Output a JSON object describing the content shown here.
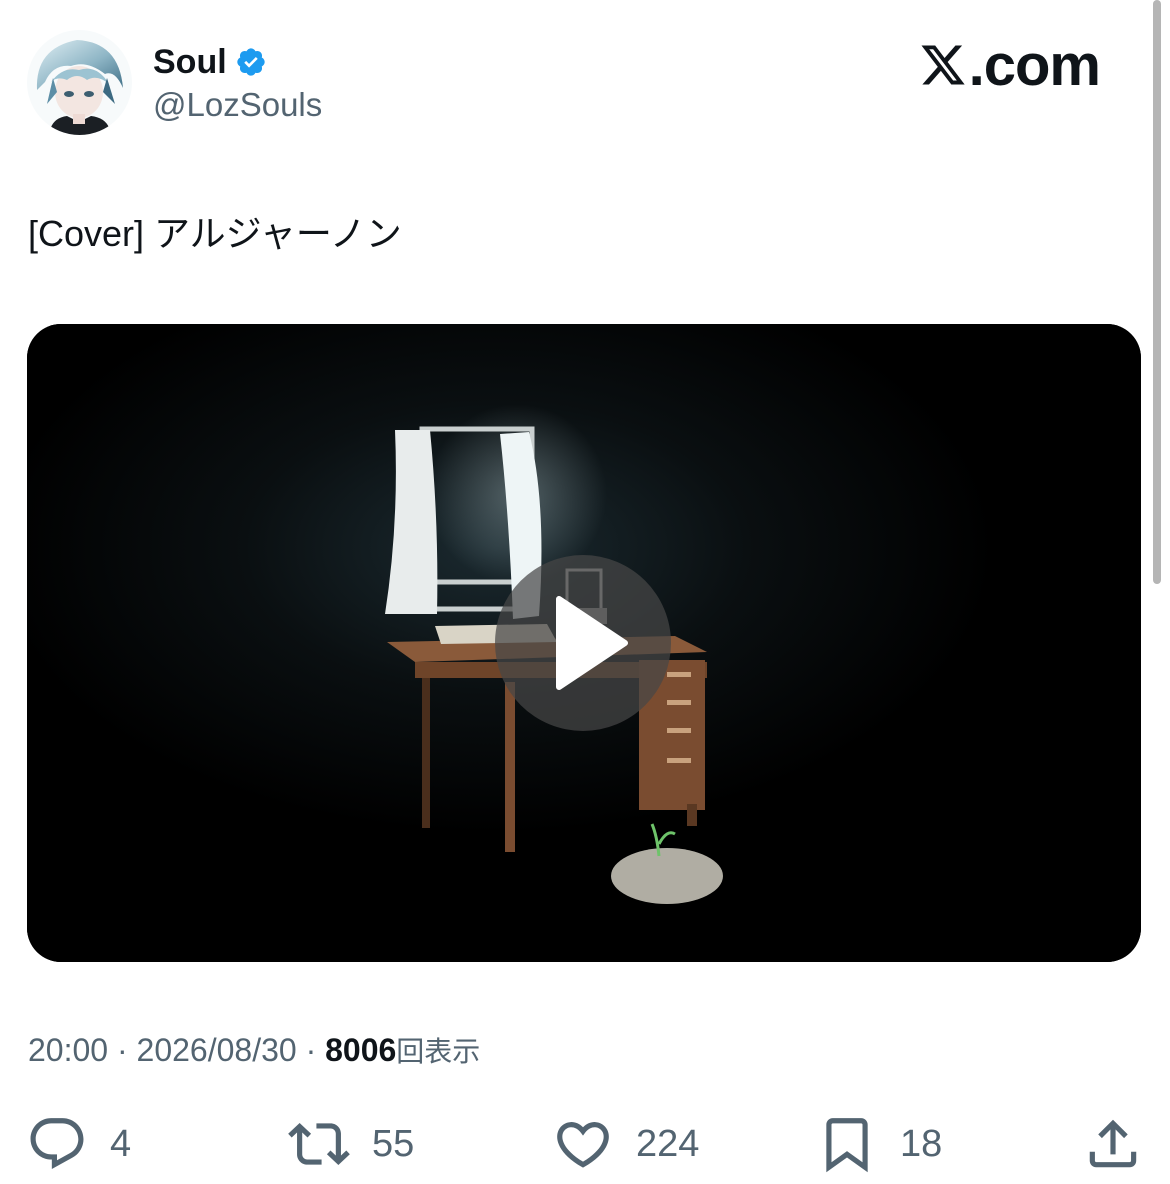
{
  "author": {
    "display_name": "Soul",
    "handle": "@LozSouls",
    "verified": true,
    "avatar_icon": "avatar-image"
  },
  "brand": {
    "text": ".com",
    "icon": "x-logo-icon"
  },
  "tweet": {
    "text": "[Cover] アルジャーノン"
  },
  "media": {
    "type": "video",
    "play_icon": "play-icon"
  },
  "meta": {
    "time": "20:00",
    "separator": " · ",
    "date": "2026/08/30",
    "views": "8006",
    "views_label": "回表示"
  },
  "actions": {
    "reply": {
      "icon": "reply-icon",
      "count": "4"
    },
    "repost": {
      "icon": "repost-icon",
      "count": "55"
    },
    "like": {
      "icon": "heart-icon",
      "count": "224"
    },
    "bookmark": {
      "icon": "bookmark-icon",
      "count": "18"
    },
    "share": {
      "icon": "share-icon"
    }
  },
  "colors": {
    "text_primary": "#0f1419",
    "text_secondary": "#536471",
    "verified_blue": "#1d9bf0",
    "video_background": "#000000"
  }
}
